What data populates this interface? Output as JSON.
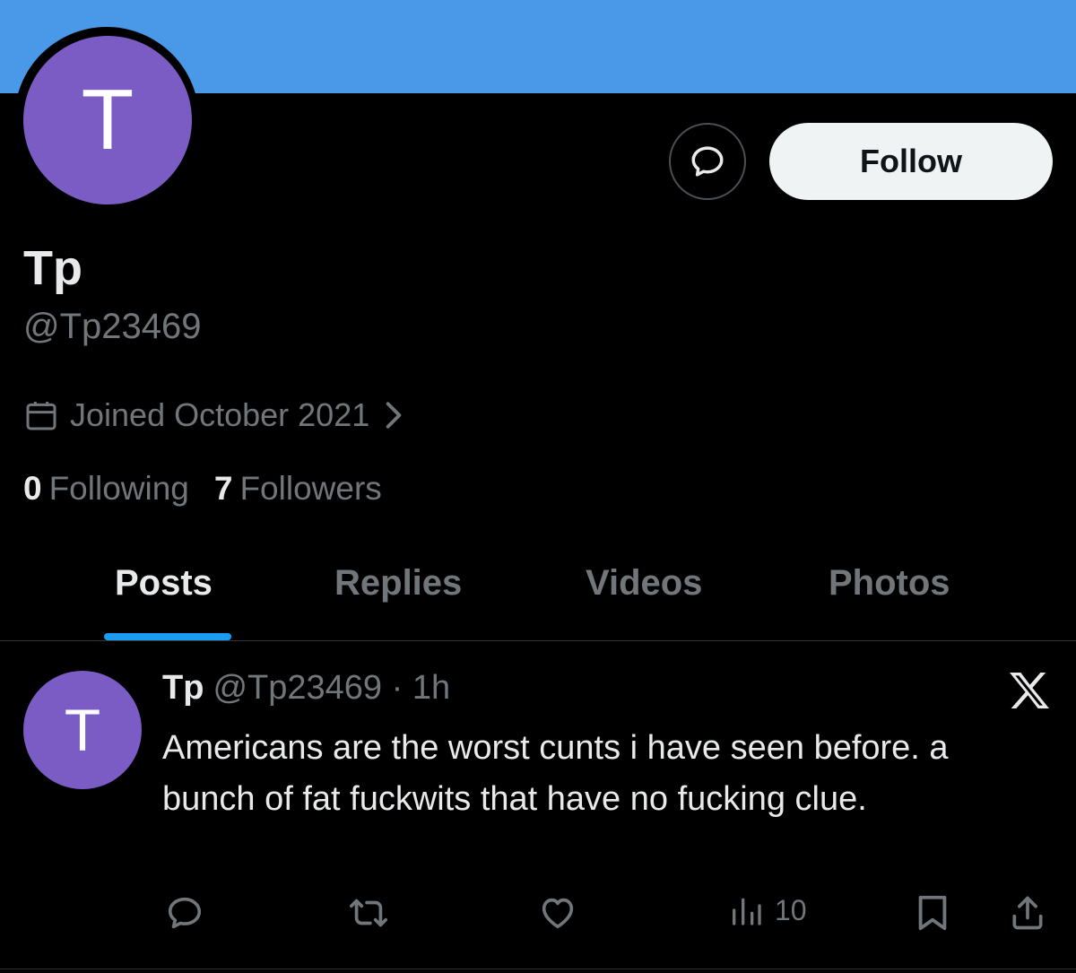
{
  "profile": {
    "avatar_initial": "T",
    "display_name": "Tp",
    "handle": "@Tp23469",
    "joined": "Joined October 2021",
    "following_count": "0",
    "following_label": "Following",
    "followers_count": "7",
    "followers_label": "Followers",
    "follow_label": "Follow"
  },
  "tabs": [
    {
      "label": "Posts",
      "active": true
    },
    {
      "label": "Replies",
      "active": false
    },
    {
      "label": "Videos",
      "active": false
    },
    {
      "label": "Photos",
      "active": false
    }
  ],
  "post": {
    "avatar_initial": "T",
    "name": "Tp",
    "handle": "@Tp23469",
    "separator": "·",
    "time": "1h",
    "text": "Americans are the worst cunts i have seen before. a bunch of fat fuckwits that have no fucking clue.",
    "views": "10"
  },
  "icons": {
    "message": "message-bubble-icon",
    "calendar": "calendar-icon",
    "chevron": "chevron-right-icon",
    "x_logo": "x-logo-icon",
    "reply": "reply-icon",
    "repost": "repost-icon",
    "like": "heart-icon",
    "views": "views-icon",
    "bookmark": "bookmark-icon",
    "share": "share-icon"
  },
  "colors": {
    "banner": "#4a99e9",
    "avatar": "#7b5cc4",
    "accent": "#1d9bf0",
    "muted": "#71767b"
  }
}
